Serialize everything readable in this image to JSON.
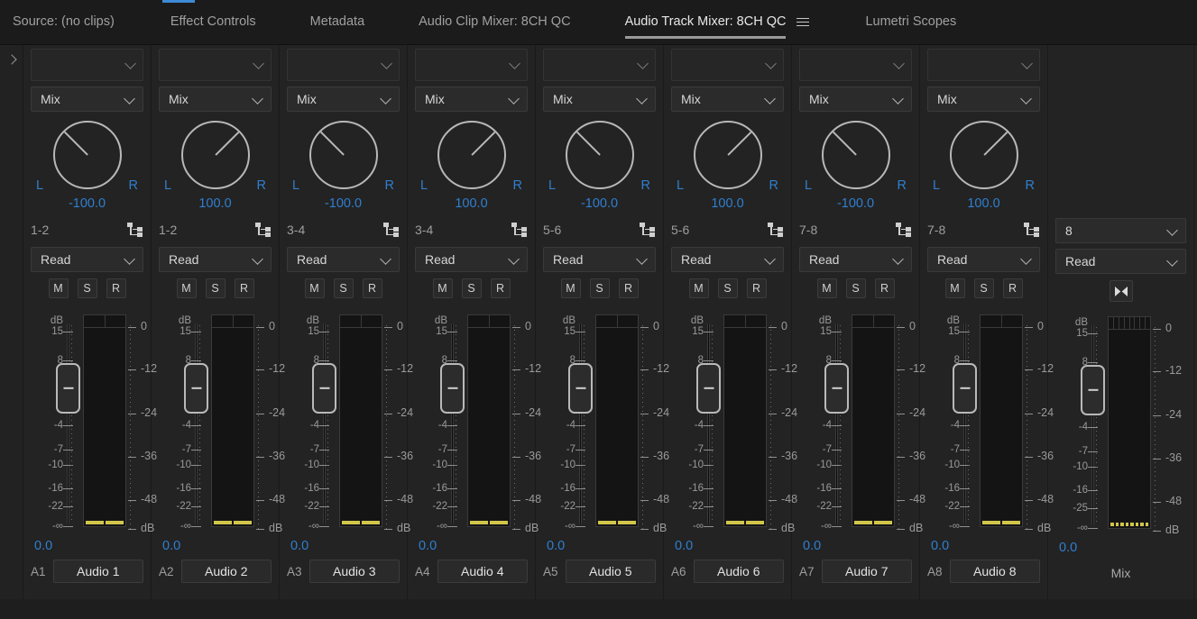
{
  "window": {
    "title": "Audio Track Mixer: 8CH QC"
  },
  "tabs": [
    {
      "label": "Source: (no clips)",
      "active": false
    },
    {
      "label": "Effect Controls",
      "active": false
    },
    {
      "label": "Metadata",
      "active": false
    },
    {
      "label": "Audio Clip Mixer: 8CH QC",
      "active": false
    },
    {
      "label": "Audio Track Mixer: 8CH QC",
      "active": true
    },
    {
      "label": "Lumetri Scopes",
      "active": false
    }
  ],
  "panel_menu_icon": "hamburger-menu-icon",
  "expander_icon": "chevron-right-icon",
  "colors": {
    "accent_blue": "#2f7fd0",
    "meter_yellow": "#d2c64a",
    "panel_bg": "#232323",
    "tabbar_bg": "#1b1b1b",
    "tab_nub": "#3d8ad6"
  },
  "fader_scale": {
    "labels": [
      "dB",
      "15",
      "8",
      "0",
      "-4",
      "-7",
      "-10",
      "-16",
      "-22",
      "-∞"
    ]
  },
  "fader_scale_master": {
    "labels": [
      "dB",
      "15",
      "8",
      "0",
      "-4",
      "-7",
      "-10",
      "-16",
      "-25",
      "-∞"
    ]
  },
  "meter_scale": {
    "labels": [
      "0",
      "-12",
      "-24",
      "-36",
      "-48",
      "dB"
    ]
  },
  "msr_buttons": [
    "M",
    "S",
    "R"
  ],
  "strips": [
    {
      "fx": "",
      "output": "Mix",
      "pan": "-100.0",
      "pan_dir": "left",
      "channels": "1-2",
      "automation": "Read",
      "gain": "0.0",
      "track_id": "A1",
      "track_name": "Audio 1",
      "meter_segments": 2
    },
    {
      "fx": "",
      "output": "Mix",
      "pan": "100.0",
      "pan_dir": "right",
      "channels": "1-2",
      "automation": "Read",
      "gain": "0.0",
      "track_id": "A2",
      "track_name": "Audio 2",
      "meter_segments": 2
    },
    {
      "fx": "",
      "output": "Mix",
      "pan": "-100.0",
      "pan_dir": "left",
      "channels": "3-4",
      "automation": "Read",
      "gain": "0.0",
      "track_id": "A3",
      "track_name": "Audio 3",
      "meter_segments": 2
    },
    {
      "fx": "",
      "output": "Mix",
      "pan": "100.0",
      "pan_dir": "right",
      "channels": "3-4",
      "automation": "Read",
      "gain": "0.0",
      "track_id": "A4",
      "track_name": "Audio 4",
      "meter_segments": 2
    },
    {
      "fx": "",
      "output": "Mix",
      "pan": "-100.0",
      "pan_dir": "left",
      "channels": "5-6",
      "automation": "Read",
      "gain": "0.0",
      "track_id": "A5",
      "track_name": "Audio 5",
      "meter_segments": 2
    },
    {
      "fx": "",
      "output": "Mix",
      "pan": "100.0",
      "pan_dir": "right",
      "channels": "5-6",
      "automation": "Read",
      "gain": "0.0",
      "track_id": "A6",
      "track_name": "Audio 6",
      "meter_segments": 2
    },
    {
      "fx": "",
      "output": "Mix",
      "pan": "-100.0",
      "pan_dir": "left",
      "channels": "7-8",
      "automation": "Read",
      "gain": "0.0",
      "track_id": "A7",
      "track_name": "Audio 7",
      "meter_segments": 2
    },
    {
      "fx": "",
      "output": "Mix",
      "pan": "100.0",
      "pan_dir": "right",
      "channels": "7-8",
      "automation": "Read",
      "gain": "0.0",
      "track_id": "A8",
      "track_name": "Audio 8",
      "meter_segments": 2
    }
  ],
  "master": {
    "channel_count": "8",
    "automation": "Read",
    "gain": "0.0",
    "label": "Mix",
    "meter_segments": 8,
    "icon": "bowtie-icon"
  },
  "pan_labels": {
    "left": "L",
    "right": "R"
  }
}
